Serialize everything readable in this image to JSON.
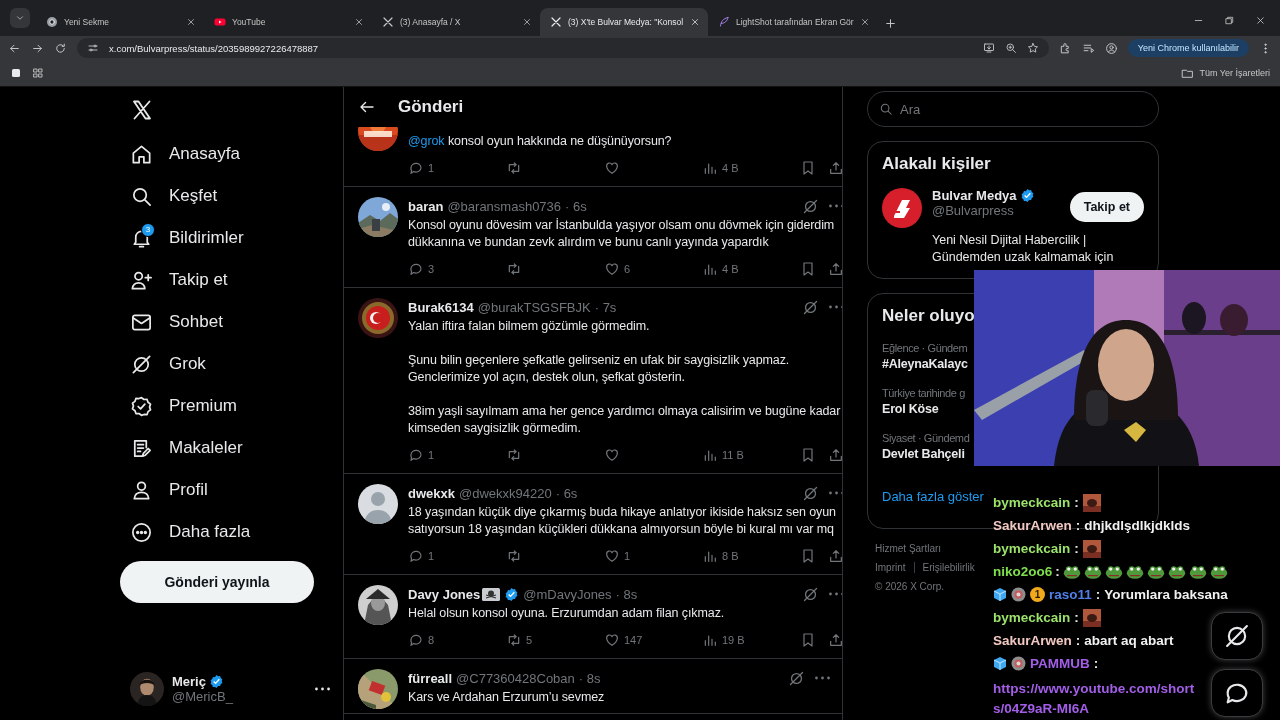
{
  "browser": {
    "tabs": [
      {
        "title": "Yeni Sekme",
        "selected": false
      },
      {
        "title": "YouTube",
        "selected": false
      },
      {
        "title": "(3) Anasayfa / X",
        "selected": false
      },
      {
        "title": "(3) X'te Bulvar Medya: \"Konsol",
        "selected": true
      },
      {
        "title": "LightShot tarafından Ekran Gör",
        "selected": false
      }
    ],
    "address": "x.com/Bulvarpress/status/2035989927226478887",
    "update_button": "Yeni Chrome kullanılabilir",
    "bookmarks_folder": "Tüm Yer İşaretleri"
  },
  "nav": {
    "items": [
      {
        "label": "Anasayfa",
        "selected": false
      },
      {
        "label": "Keşfet",
        "selected": false
      },
      {
        "label": "Bildirimler",
        "badge": "3",
        "selected": false
      },
      {
        "label": "Takip et",
        "selected": false
      },
      {
        "label": "Sohbet",
        "selected": false
      },
      {
        "label": "Grok",
        "selected": false
      },
      {
        "label": "Premium",
        "selected": false
      },
      {
        "label": "Makaleler",
        "selected": false
      },
      {
        "label": "Profil",
        "selected": false
      },
      {
        "label": "Daha fazla",
        "selected": false
      }
    ],
    "post_button": "Gönderi yayınla",
    "account": {
      "name": "Meriç",
      "handle": "@MericB_",
      "verified": true
    }
  },
  "post": {
    "title": "Gönderi",
    "tweets": [
      {
        "mention": "@grok",
        "text": "konsol oyun hakkında ne düşünüyorsun?",
        "replies": "1",
        "views": "4 B"
      },
      {
        "name": "baran",
        "handle": "@baransmash0736",
        "time": "· 6s",
        "text": "Konsol oyunu dövesim var İstanbulda yaşıyor olsam onu dövmek için giderdim dükkanına ve bundan zevk alırdım ve bunu canlı yayında yapardık",
        "replies": "3",
        "likes": "6",
        "views": "4 B"
      },
      {
        "name": "Burak6134",
        "handle": "@burakTSGSFBJK",
        "time": "· 7s",
        "text": "Yalan iftira falan bilmem gözümle görmedim.\n\nŞunu bilin geçenlere şefkatle gelirseniz en ufak bir saygisizlik yapmaz. Genclerimize yol açın, destek olun, şefkat gösterin.\n\n38im yaşli sayılmam ama her gence yardımcı olmaya calisirim ve bugüne kadar kimseden saygisizlik görmedim.",
        "replies": "1",
        "views": "11 B"
      },
      {
        "name": "dwekxk",
        "handle": "@dwekxk94220",
        "time": "· 6s",
        "text": "18 yaşından küçük diye çıkarmış buda hikaye anlatıyor ikiside haksız sen oyun satıyorsun 18 yaşından küçükleri dükkana almıyorsun böyle bi kural mı var mq",
        "replies": "1",
        "likes": "1",
        "views": "8 B"
      },
      {
        "name": "Davy Jones",
        "flag": true,
        "verified": true,
        "handle": "@mDavyJones",
        "time": "· 8s",
        "text": "Helal olsun konsol oyuna. Erzurumdan adam filan çıkmaz.",
        "replies": "8",
        "reposts": "5",
        "likes": "147",
        "views": "19 B"
      },
      {
        "name": "fürreall",
        "handle": "@C77360428Coban",
        "time": "· 8s",
        "text": "Kars ve Ardahan Erzurum’u sevmez"
      }
    ]
  },
  "sidebar": {
    "search": {
      "placeholder": "Ara"
    },
    "related": {
      "title": "Alakalı kişiler",
      "people": [
        {
          "name": "Bulvar Medya",
          "verified": true,
          "handle": "@Bulvarpress",
          "bio": "Yeni Nesil Dijital Habercilik | Gündemden uzak kalmamak için",
          "button": "Takip et"
        }
      ]
    },
    "trends": {
      "title": "Neler oluyo",
      "items": [
        {
          "category": "Eğlence · Gündem",
          "title": "#AleynaKalayc"
        },
        {
          "category": "Türkiye tarihinde g",
          "title": "Erol Köse"
        },
        {
          "category": "Siyaset · Gündemd",
          "title": "Devlet Bahçeli"
        }
      ],
      "more": "Daha fazla göster"
    },
    "footer": [
      [
        "Hizmet Şartları"
      ],
      [
        "Imprint",
        "Erişilebilirlik"
      ]
    ],
    "copyright": "© 2026 X Corp."
  },
  "stream": {
    "chat": [
      {
        "user": "bymeckcain",
        "color": "#9be36a",
        "colon": ":",
        "emotes": [
          {
            "kind": "face"
          }
        ]
      },
      {
        "user": "SakurArwen",
        "color": "#f2c9c2",
        "colon": ":",
        "text": "dhjkdlşdlkjdklds"
      },
      {
        "user": "bymeckcain",
        "color": "#9be36a",
        "colon": ":",
        "emotes": [
          {
            "kind": "face"
          }
        ]
      },
      {
        "user": "niko2oo6",
        "color": "#7fe04c",
        "colon": ":",
        "emotes": [
          {
            "kind": "frog"
          },
          {
            "kind": "frog"
          },
          {
            "kind": "frog"
          },
          {
            "kind": "frog"
          },
          {
            "kind": "frog"
          },
          {
            "kind": "frog"
          },
          {
            "kind": "frog"
          },
          {
            "kind": "frog"
          }
        ]
      },
      {
        "badges": [
          {
            "kind": "cube"
          },
          {
            "kind": "ring"
          },
          {
            "kind": "medal",
            "label": "1"
          }
        ],
        "user": "raso11",
        "color": "#4f7fe8",
        "colon": ":",
        "text": "Yorumlara baksana"
      },
      {
        "user": "bymeckcain",
        "color": "#9be36a",
        "colon": ":",
        "emotes": [
          {
            "kind": "face"
          }
        ]
      },
      {
        "user": "SakurArwen",
        "color": "#f2c9c2",
        "colon": ":",
        "text": "abart aq abart"
      },
      {
        "badges": [
          {
            "kind": "cube"
          },
          {
            "kind": "ring"
          }
        ],
        "user": "PAMMUB",
        "color": "#a35ee8",
        "colon": ":",
        "link": "https://www.youtube.com/shorts/04Z9aR-MI6A"
      }
    ]
  }
}
